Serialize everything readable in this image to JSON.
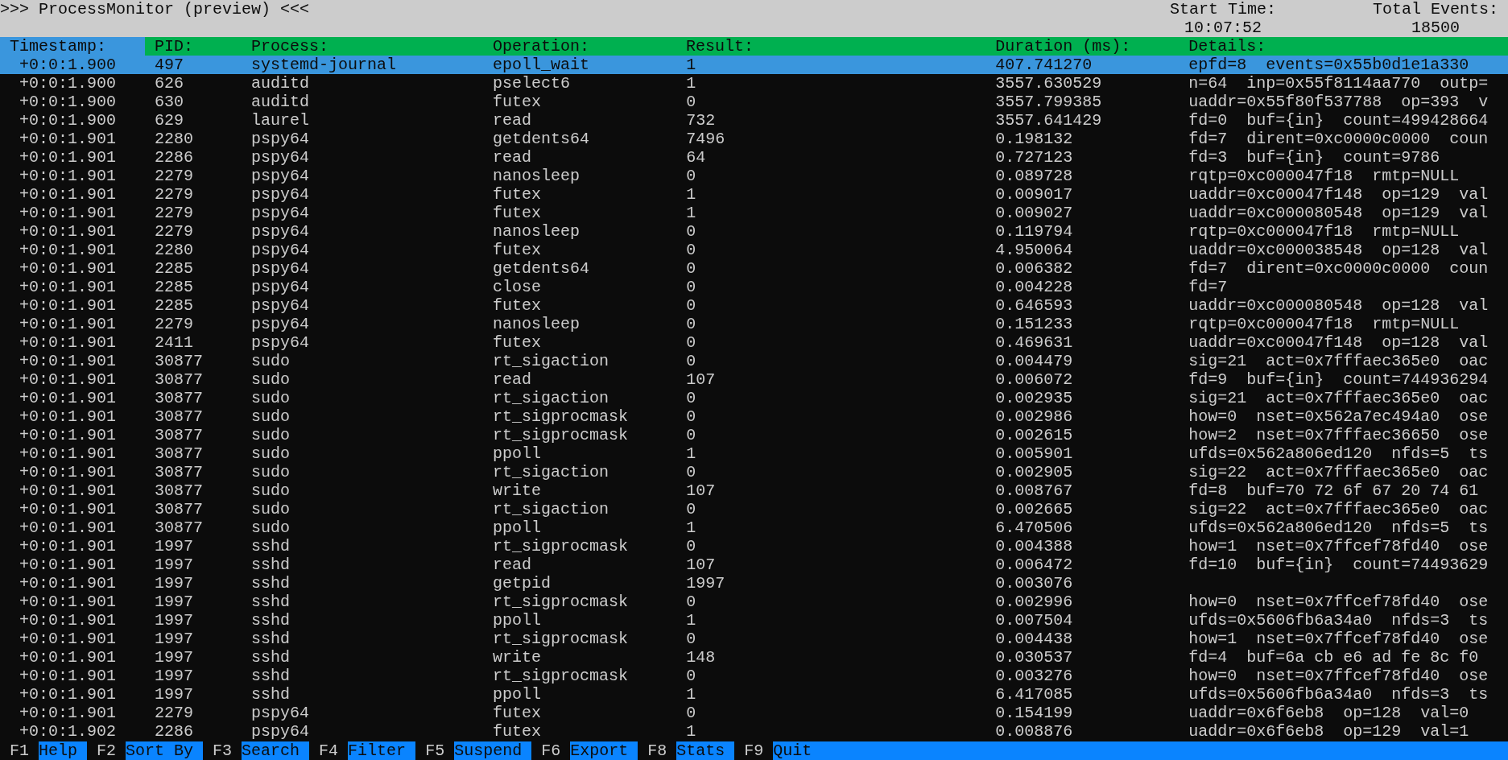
{
  "title_bar": {
    "title": ">>> ProcessMonitor (preview) <<<",
    "stats": [
      {
        "label": "Start Time:",
        "value": "10:07:52"
      },
      {
        "label": "Total Events:",
        "value": "18500"
      }
    ]
  },
  "table": {
    "columns": [
      {
        "label": "Timestamp:",
        "selected": true
      },
      {
        "label": "PID:",
        "selected": false
      },
      {
        "label": "Process:",
        "selected": false
      },
      {
        "label": "Operation:",
        "selected": false
      },
      {
        "label": "Result:",
        "selected": false
      },
      {
        "label": "Duration (ms):",
        "selected": false
      },
      {
        "label": "Details:",
        "selected": false
      }
    ],
    "rows": [
      {
        "selected": true,
        "cells": [
          "+0:0:1.900",
          "497",
          "systemd-journal",
          "epoll_wait",
          "1",
          "407.741270",
          "epfd=8  events=0x55b0d1e1a330"
        ]
      },
      {
        "selected": false,
        "cells": [
          "+0:0:1.900",
          "626",
          "auditd",
          "pselect6",
          "1",
          "3557.630529",
          "n=64  inp=0x55f8114aa770  outp="
        ]
      },
      {
        "selected": false,
        "cells": [
          "+0:0:1.900",
          "630",
          "auditd",
          "futex",
          "0",
          "3557.799385",
          "uaddr=0x55f80f537788  op=393  v"
        ]
      },
      {
        "selected": false,
        "cells": [
          "+0:0:1.900",
          "629",
          "laurel",
          "read",
          "732",
          "3557.641429",
          "fd=0  buf={in}  count=499428664"
        ]
      },
      {
        "selected": false,
        "cells": [
          "+0:0:1.901",
          "2280",
          "pspy64",
          "getdents64",
          "7496",
          "0.198132",
          "fd=7  dirent=0xc0000c0000  coun"
        ]
      },
      {
        "selected": false,
        "cells": [
          "+0:0:1.901",
          "2286",
          "pspy64",
          "read",
          "64",
          "0.727123",
          "fd=3  buf={in}  count=9786"
        ]
      },
      {
        "selected": false,
        "cells": [
          "+0:0:1.901",
          "2279",
          "pspy64",
          "nanosleep",
          "0",
          "0.089728",
          "rqtp=0xc000047f18  rmtp=NULL"
        ]
      },
      {
        "selected": false,
        "cells": [
          "+0:0:1.901",
          "2279",
          "pspy64",
          "futex",
          "1",
          "0.009017",
          "uaddr=0xc00047f148  op=129  val"
        ]
      },
      {
        "selected": false,
        "cells": [
          "+0:0:1.901",
          "2279",
          "pspy64",
          "futex",
          "1",
          "0.009027",
          "uaddr=0xc000080548  op=129  val"
        ]
      },
      {
        "selected": false,
        "cells": [
          "+0:0:1.901",
          "2279",
          "pspy64",
          "nanosleep",
          "0",
          "0.119794",
          "rqtp=0xc000047f18  rmtp=NULL"
        ]
      },
      {
        "selected": false,
        "cells": [
          "+0:0:1.901",
          "2280",
          "pspy64",
          "futex",
          "0",
          "4.950064",
          "uaddr=0xc000038548  op=128  val"
        ]
      },
      {
        "selected": false,
        "cells": [
          "+0:0:1.901",
          "2285",
          "pspy64",
          "getdents64",
          "0",
          "0.006382",
          "fd=7  dirent=0xc0000c0000  coun"
        ]
      },
      {
        "selected": false,
        "cells": [
          "+0:0:1.901",
          "2285",
          "pspy64",
          "close",
          "0",
          "0.004228",
          "fd=7"
        ]
      },
      {
        "selected": false,
        "cells": [
          "+0:0:1.901",
          "2285",
          "pspy64",
          "futex",
          "0",
          "0.646593",
          "uaddr=0xc000080548  op=128  val"
        ]
      },
      {
        "selected": false,
        "cells": [
          "+0:0:1.901",
          "2279",
          "pspy64",
          "nanosleep",
          "0",
          "0.151233",
          "rqtp=0xc000047f18  rmtp=NULL"
        ]
      },
      {
        "selected": false,
        "cells": [
          "+0:0:1.901",
          "2411",
          "pspy64",
          "futex",
          "0",
          "0.469631",
          "uaddr=0xc00047f148  op=128  val"
        ]
      },
      {
        "selected": false,
        "cells": [
          "+0:0:1.901",
          "30877",
          "sudo",
          "rt_sigaction",
          "0",
          "0.004479",
          "sig=21  act=0x7fffaec365e0  oac"
        ]
      },
      {
        "selected": false,
        "cells": [
          "+0:0:1.901",
          "30877",
          "sudo",
          "read",
          "107",
          "0.006072",
          "fd=9  buf={in}  count=744936294"
        ]
      },
      {
        "selected": false,
        "cells": [
          "+0:0:1.901",
          "30877",
          "sudo",
          "rt_sigaction",
          "0",
          "0.002935",
          "sig=21  act=0x7fffaec365e0  oac"
        ]
      },
      {
        "selected": false,
        "cells": [
          "+0:0:1.901",
          "30877",
          "sudo",
          "rt_sigprocmask",
          "0",
          "0.002986",
          "how=0  nset=0x562a7ec494a0  ose"
        ]
      },
      {
        "selected": false,
        "cells": [
          "+0:0:1.901",
          "30877",
          "sudo",
          "rt_sigprocmask",
          "0",
          "0.002615",
          "how=2  nset=0x7fffaec36650  ose"
        ]
      },
      {
        "selected": false,
        "cells": [
          "+0:0:1.901",
          "30877",
          "sudo",
          "ppoll",
          "1",
          "0.005901",
          "ufds=0x562a806ed120  nfds=5  ts"
        ]
      },
      {
        "selected": false,
        "cells": [
          "+0:0:1.901",
          "30877",
          "sudo",
          "rt_sigaction",
          "0",
          "0.002905",
          "sig=22  act=0x7fffaec365e0  oac"
        ]
      },
      {
        "selected": false,
        "cells": [
          "+0:0:1.901",
          "30877",
          "sudo",
          "write",
          "107",
          "0.008767",
          "fd=8  buf=70 72 6f 67 20 74 61"
        ]
      },
      {
        "selected": false,
        "cells": [
          "+0:0:1.901",
          "30877",
          "sudo",
          "rt_sigaction",
          "0",
          "0.002665",
          "sig=22  act=0x7fffaec365e0  oac"
        ]
      },
      {
        "selected": false,
        "cells": [
          "+0:0:1.901",
          "30877",
          "sudo",
          "ppoll",
          "1",
          "6.470506",
          "ufds=0x562a806ed120  nfds=5  ts"
        ]
      },
      {
        "selected": false,
        "cells": [
          "+0:0:1.901",
          "1997",
          "sshd",
          "rt_sigprocmask",
          "0",
          "0.004388",
          "how=1  nset=0x7ffcef78fd40  ose"
        ]
      },
      {
        "selected": false,
        "cells": [
          "+0:0:1.901",
          "1997",
          "sshd",
          "read",
          "107",
          "0.006472",
          "fd=10  buf={in}  count=74493629"
        ]
      },
      {
        "selected": false,
        "cells": [
          "+0:0:1.901",
          "1997",
          "sshd",
          "getpid",
          "1997",
          "0.003076"
        ]
      },
      {
        "selected": false,
        "cells": [
          "+0:0:1.901",
          "1997",
          "sshd",
          "rt_sigprocmask",
          "0",
          "0.002996",
          "how=0  nset=0x7ffcef78fd40  ose"
        ]
      },
      {
        "selected": false,
        "cells": [
          "+0:0:1.901",
          "1997",
          "sshd",
          "ppoll",
          "1",
          "0.007504",
          "ufds=0x5606fb6a34a0  nfds=3  ts"
        ]
      },
      {
        "selected": false,
        "cells": [
          "+0:0:1.901",
          "1997",
          "sshd",
          "rt_sigprocmask",
          "0",
          "0.004438",
          "how=1  nset=0x7ffcef78fd40  ose"
        ]
      },
      {
        "selected": false,
        "cells": [
          "+0:0:1.901",
          "1997",
          "sshd",
          "write",
          "148",
          "0.030537",
          "fd=4  buf=6a cb e6 ad fe 8c f0"
        ]
      },
      {
        "selected": false,
        "cells": [
          "+0:0:1.901",
          "1997",
          "sshd",
          "rt_sigprocmask",
          "0",
          "0.003276",
          "how=0  nset=0x7ffcef78fd40  ose"
        ]
      },
      {
        "selected": false,
        "cells": [
          "+0:0:1.901",
          "1997",
          "sshd",
          "ppoll",
          "1",
          "6.417085",
          "ufds=0x5606fb6a34a0  nfds=3  ts"
        ]
      },
      {
        "selected": false,
        "cells": [
          "+0:0:1.901",
          "2279",
          "pspy64",
          "futex",
          "0",
          "0.154199",
          "uaddr=0x6f6eb8  op=128  val=0"
        ]
      },
      {
        "selected": false,
        "cells": [
          "+0:0:1.902",
          "2286",
          "pspy64",
          "futex",
          "1",
          "0.008876",
          "uaddr=0x6f6eb8  op=129  val=1"
        ]
      }
    ]
  },
  "footer": [
    {
      "key": "F1",
      "label": "Help"
    },
    {
      "key": "F2",
      "label": "Sort By"
    },
    {
      "key": "F3",
      "label": "Search"
    },
    {
      "key": "F4",
      "label": "Filter"
    },
    {
      "key": "F5",
      "label": "Suspend"
    },
    {
      "key": "F6",
      "label": "Export"
    },
    {
      "key": "F8",
      "label": "Stats"
    },
    {
      "key": "F9",
      "label": "Quit"
    }
  ]
}
